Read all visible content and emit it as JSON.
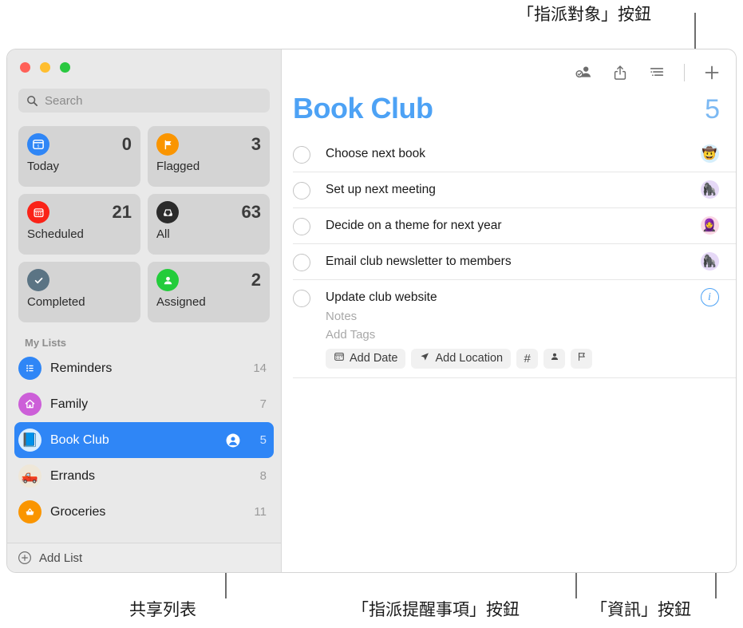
{
  "annotations": [
    {
      "id": "assign-to",
      "text": "「指派對象」按鈕"
    },
    {
      "id": "shared-list",
      "text": "共享列表"
    },
    {
      "id": "assign-rem",
      "text": "「指派提醒事項」按鈕"
    },
    {
      "id": "info",
      "text": "「資訊」按鈕"
    }
  ],
  "window": {
    "traffic_lights": {
      "close": "close-button",
      "minimize": "minimize-button",
      "zoom": "zoom-button"
    }
  },
  "sidebar": {
    "search": {
      "placeholder": "Search",
      "value": ""
    },
    "smart_lists": [
      {
        "label": "Today",
        "count": "0",
        "icon": "calendar-today-icon",
        "color": "#2f86f6"
      },
      {
        "label": "Flagged",
        "count": "3",
        "icon": "flag-icon",
        "color": "#fa9500"
      },
      {
        "label": "Scheduled",
        "count": "21",
        "icon": "calendar-icon",
        "color": "#fa2318"
      },
      {
        "label": "All",
        "count": "63",
        "icon": "inbox-icon",
        "color": "#2b2b2b"
      },
      {
        "label": "Completed",
        "count": "",
        "icon": "checkmark-icon",
        "color": "#5b7484"
      },
      {
        "label": "Assigned",
        "count": "2",
        "icon": "person-icon",
        "color": "#23cc3b"
      }
    ],
    "my_lists_header": "My Lists",
    "lists": [
      {
        "label": "Reminders",
        "count": "14",
        "icon": "bulleted-list-icon",
        "emoji": "",
        "bg": "#2f86f6",
        "selected": false,
        "shared": false
      },
      {
        "label": "Family",
        "count": "7",
        "icon": "house-icon",
        "emoji": "",
        "bg": "#cc5fd8",
        "selected": false,
        "shared": false
      },
      {
        "label": "Book Club",
        "count": "5",
        "icon": "book-icon",
        "emoji": "📘",
        "bg": "#dbeeff",
        "selected": true,
        "shared": true
      },
      {
        "label": "Errands",
        "count": "8",
        "icon": "truck-icon",
        "emoji": "🛻",
        "bg": "#efe7d8",
        "selected": false,
        "shared": false
      },
      {
        "label": "Groceries",
        "count": "11",
        "icon": "basket-icon",
        "emoji": "",
        "bg": "#fa9500",
        "selected": false,
        "shared": false
      }
    ],
    "add_list_label": "Add List"
  },
  "main": {
    "toolbar": [
      {
        "name": "assign-to-button",
        "icon": "person-badge-check-icon"
      },
      {
        "name": "share-button",
        "icon": "share-icon"
      },
      {
        "name": "view-options-button",
        "icon": "list-view-icon"
      },
      {
        "name": "add-reminder-button",
        "icon": "plus-icon"
      }
    ],
    "title": "Book Club",
    "total_count": "5",
    "tasks": [
      {
        "title": "Choose next book",
        "avatar": "🤠",
        "avatar_bg": "#d5eefb",
        "expanded": false,
        "info": false
      },
      {
        "title": "Set up next meeting",
        "avatar": "🦍",
        "avatar_bg": "#e6d9f7",
        "expanded": false,
        "info": false
      },
      {
        "title": "Decide on a theme for next year",
        "avatar": "🧕",
        "avatar_bg": "#fad6e4",
        "expanded": false,
        "info": false
      },
      {
        "title": "Email club newsletter to members",
        "avatar": "🦍",
        "avatar_bg": "#e6d9f7",
        "expanded": false,
        "info": false
      },
      {
        "title": "Update club website",
        "avatar": "",
        "avatar_bg": "",
        "expanded": true,
        "info": true,
        "notes_placeholder": "Notes",
        "tags_placeholder": "Add Tags",
        "chips": [
          {
            "label": "Add Date",
            "icon": "calendar-icon",
            "name": "add-date-button"
          },
          {
            "label": "Add Location",
            "icon": "location-icon",
            "name": "add-location-button"
          },
          {
            "label": "#",
            "icon": "tag-icon",
            "name": "add-tag-button"
          },
          {
            "label": "",
            "icon": "person-icon",
            "name": "assign-reminder-button"
          },
          {
            "label": "",
            "icon": "flag-icon",
            "name": "flag-button"
          }
        ]
      }
    ]
  }
}
